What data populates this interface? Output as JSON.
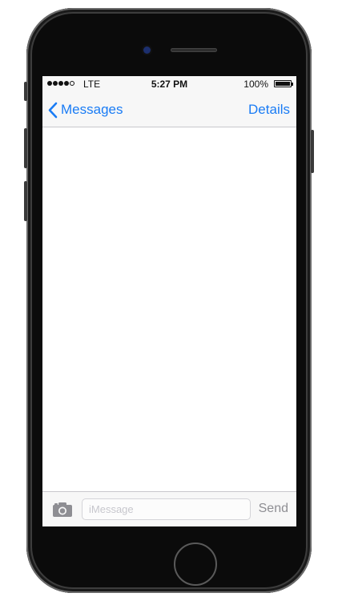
{
  "status_bar": {
    "carrier": "LTE",
    "time": "5:27 PM",
    "battery_percent": "100%",
    "battery_level": 1.0,
    "signal_bars_filled": 4,
    "signal_bars_total": 5
  },
  "nav_bar": {
    "back_label": "Messages",
    "right_label": "Details",
    "accent_color": "#1a7cf5"
  },
  "compose": {
    "placeholder": "iMessage",
    "value": "",
    "send_label": "Send",
    "camera_icon": "camera-icon"
  }
}
